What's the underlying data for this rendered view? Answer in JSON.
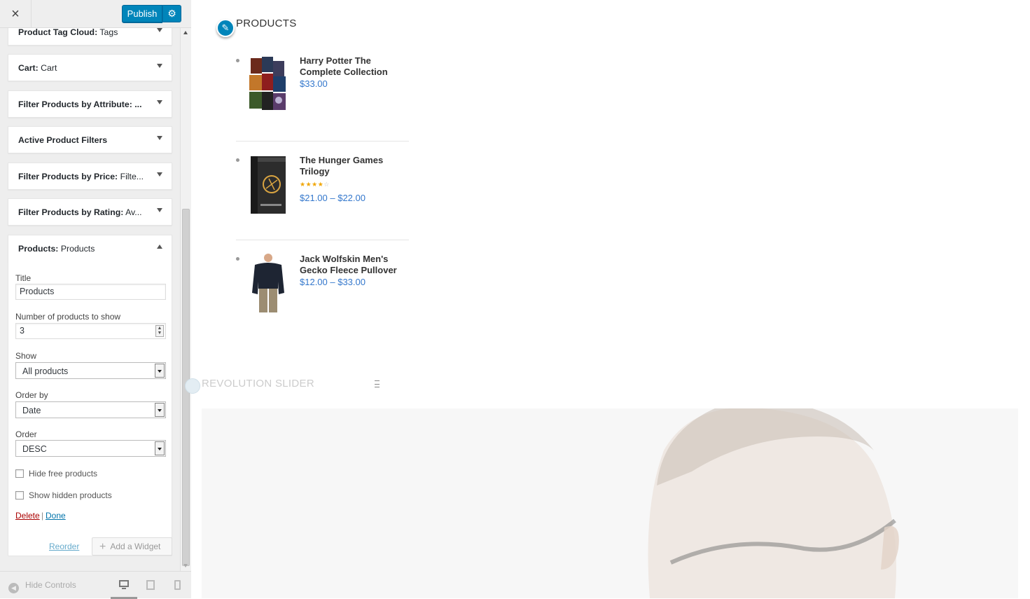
{
  "header": {
    "close_icon": "×",
    "publish_label": "Publish",
    "settings_icon": "⚙"
  },
  "widgets": [
    {
      "type": "Product Tag Cloud:",
      "name": "Tags"
    },
    {
      "type": "Cart:",
      "name": "Cart"
    },
    {
      "type": "Filter Products by Attribute: ...",
      "name": ""
    },
    {
      "type": "Active Product Filters",
      "name": ""
    },
    {
      "type": "Filter Products by Price:",
      "name": "Filte..."
    },
    {
      "type": "Filter Products by Rating:",
      "name": "Av..."
    },
    {
      "type": "Products:",
      "name": "Products"
    }
  ],
  "form": {
    "title_label": "Title",
    "title_value": "Products",
    "number_label": "Number of products to show",
    "number_value": "3",
    "show_label": "Show",
    "show_value": "All products",
    "orderby_label": "Order by",
    "orderby_value": "Date",
    "order_label": "Order",
    "order_value": "DESC",
    "hide_free_label": "Hide free products",
    "show_hidden_label": "Show hidden products",
    "delete_label": "Delete",
    "separator": "|",
    "done_label": "Done"
  },
  "actions": {
    "reorder_label": "Reorder",
    "add_widget_label": "Add a Widget"
  },
  "footer": {
    "hide_controls_label": "Hide Controls"
  },
  "preview": {
    "products_heading": "PRODUCTS",
    "products": [
      {
        "name": "Harry Potter The Complete Collection",
        "price": "$33.00",
        "rating": null
      },
      {
        "name": "The Hunger Games Trilogy",
        "price": "$21.00 – $22.00",
        "rating": 4
      },
      {
        "name": "Jack Wolfskin Men's Gecko Fleece Pullover",
        "price": "$12.00 – $33.00",
        "rating": null
      }
    ],
    "revolution_heading": "REVOLUTION SLIDER"
  },
  "colors": {
    "accent": "#0085ba",
    "price": "#3377cc",
    "delete": "#aa0000",
    "star": "#f0a500"
  }
}
